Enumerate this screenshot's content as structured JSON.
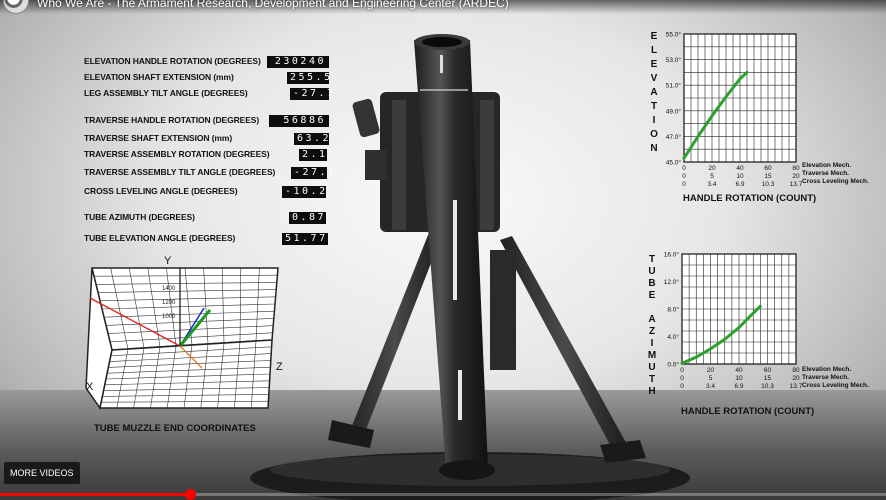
{
  "video": {
    "title": "Who We Are - The Armament Research, Development and Engineering Center (ARDEC)"
  },
  "readouts": [
    {
      "label": "ELEVATION HANDLE ROTATION (DEGREES)",
      "value": "230240"
    },
    {
      "label": "ELEVATION SHAFT EXTENSION (mm)",
      "value": "255.5"
    },
    {
      "label": "LEG ASSEMBLY TILT ANGLE  (DEGREES)",
      "value": "-27.7"
    },
    {
      "label": "TRAVERSE HANDLE ROTATION (DEGREES)",
      "value": "56886"
    },
    {
      "label": "TRAVERSE SHAFT EXTENSION (mm)",
      "value": "63.2"
    },
    {
      "label": "TRAVERSE ASSEMBLY ROTATION (DEGREES)",
      "value": "2.1"
    },
    {
      "label": "TRAVERSE ASSEMBLY TILT ANGLE (DEGREES)",
      "value": "-27.1"
    },
    {
      "label": "CROSS LEVELING ANGLE (DEGREES)",
      "value": "-10.2"
    },
    {
      "label": "TUBE AZIMUTH (DEGREES)",
      "value": "0.87"
    },
    {
      "label": "TUBE ELEVATION ANGLE (DEGREES)",
      "value": "51.77"
    }
  ],
  "coordinates_plot": {
    "caption": "TUBE MUZZLE END COORDINATES",
    "axes": {
      "x": "X",
      "y": "Y",
      "z": "Z"
    },
    "y_ticks": [
      "1400",
      "1200",
      "1000"
    ]
  },
  "mech_labels": {
    "elevation": "Elevation Mech.",
    "traverse": "Traverse Mech.",
    "cross": "Cross Leveling Mech."
  },
  "chart_data": [
    {
      "type": "line",
      "title": "",
      "ylabel": "ELEVATION",
      "xlabel": "HANDLE ROTATION (COUNT)",
      "ylim": [
        45,
        55
      ],
      "y_ticks": [
        "45.0°",
        "47.0°",
        "49.0°",
        "51.0°",
        "53.0°",
        "55.0°"
      ],
      "x_tick_rows": [
        {
          "name": "Elevation Mech.",
          "ticks": [
            "0",
            "20",
            "40",
            "60",
            "80"
          ]
        },
        {
          "name": "Traverse Mech.",
          "ticks": [
            "0",
            "5",
            "10",
            "15",
            "20"
          ]
        },
        {
          "name": "Cross Leveling Mech.",
          "ticks": [
            "0",
            "3.4",
            "6.9",
            "10.3",
            "13.7"
          ]
        }
      ],
      "grid": true,
      "series": [
        {
          "color": "#2ea02e",
          "x": [
            0,
            10,
            20,
            30,
            40,
            45
          ],
          "y": [
            45.3,
            47.0,
            48.6,
            50.1,
            51.5,
            52.0
          ]
        }
      ]
    },
    {
      "type": "line",
      "title": "",
      "ylabel": "TUBE AZIMUTH",
      "xlabel": "HANDLE ROTATION (COUNT)",
      "ylim": [
        0,
        16
      ],
      "y_ticks": [
        "0.0°",
        "4.0°",
        "8.0°",
        "12.0°",
        "16.0°"
      ],
      "x_tick_rows": [
        {
          "name": "Elevation Mech.",
          "ticks": [
            "0",
            "20",
            "40",
            "60",
            "80"
          ]
        },
        {
          "name": "Traverse Mech.",
          "ticks": [
            "0",
            "5",
            "10",
            "15",
            "20"
          ]
        },
        {
          "name": "Cross Leveling Mech.",
          "ticks": [
            "0",
            "3.4",
            "6.9",
            "10.3",
            "13.7"
          ]
        }
      ],
      "grid": true,
      "series": [
        {
          "color": "#2ea02e",
          "x": [
            0,
            10,
            20,
            30,
            40,
            50,
            55
          ],
          "y": [
            0.1,
            1.0,
            2.2,
            3.6,
            5.3,
            7.4,
            8.4
          ]
        }
      ]
    }
  ],
  "controls": {
    "more_videos": "MORE VIDEOS",
    "progress": 0.215
  },
  "colors": {
    "progress": "#ff0000",
    "curve": "#2ea02e"
  }
}
